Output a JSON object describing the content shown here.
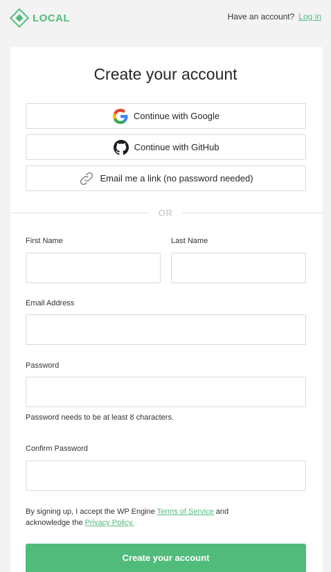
{
  "brand": {
    "name": "LOCAL",
    "color": "#51bb7b"
  },
  "header": {
    "prompt": "Have an account?",
    "login_link": "Log in"
  },
  "form": {
    "title": "Create your account",
    "social": {
      "google": "Continue with Google",
      "github": "Continue with GitHub",
      "email_link": "Email me a link (no password needed)"
    },
    "divider": "OR",
    "fields": {
      "first_name": {
        "label": "First Name",
        "value": ""
      },
      "last_name": {
        "label": "Last Name",
        "value": ""
      },
      "email": {
        "label": "Email Address",
        "value": ""
      },
      "password": {
        "label": "Password",
        "value": "",
        "hint": "Password needs to be at least 8 characters."
      },
      "confirm_password": {
        "label": "Confirm Password",
        "value": ""
      }
    },
    "legal": {
      "prefix": "By signing up, I accept the WP Engine ",
      "terms_link": "Terms of Service",
      "middle": " and acknowledge the ",
      "privacy_link": "Privacy Policy."
    },
    "submit_label": "Create your account"
  },
  "icons": {
    "logo": "local-logo-icon",
    "google": "google-icon",
    "github": "github-icon",
    "email": "link-icon"
  }
}
